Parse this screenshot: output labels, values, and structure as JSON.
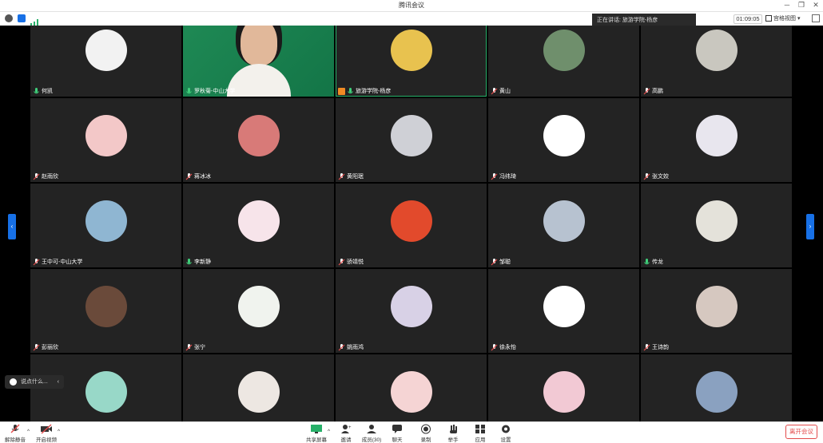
{
  "window": {
    "title": "腾讯会议"
  },
  "infobar": {
    "speaking": "正在讲话: 旅游学院-杨彦",
    "timer": "01:09:05",
    "view_label": "宫格视图"
  },
  "participants": [
    {
      "name": "何凯",
      "muted": false,
      "avatar": "stickfigure"
    },
    {
      "name": "罗秋菊-中山大学",
      "muted": false,
      "avatar": "video"
    },
    {
      "name": "旅游学院-杨彦",
      "muted": false,
      "avatar": "flowers",
      "active": true,
      "host": true
    },
    {
      "name": "黄山",
      "muted": true,
      "avatar": "mountain"
    },
    {
      "name": "高鹏",
      "muted": true,
      "avatar": "girl-outdoor"
    },
    {
      "name": "赵雨欣",
      "muted": true,
      "avatar": "pink-cartoon"
    },
    {
      "name": "蒋冰冰",
      "muted": true,
      "avatar": "person-blonde"
    },
    {
      "name": "黄阳珉",
      "muted": true,
      "avatar": "girl-hair"
    },
    {
      "name": "冯纬琦",
      "muted": true,
      "avatar": "cartoon-boy"
    },
    {
      "name": "张文姣",
      "muted": true,
      "avatar": "anime-girl"
    },
    {
      "name": "王中可-中山大学",
      "muted": true,
      "avatar": "sea-sky"
    },
    {
      "name": "李新静",
      "muted": false,
      "avatar": "two-girls"
    },
    {
      "name": "骄靖悦",
      "muted": true,
      "avatar": "cartoon-red"
    },
    {
      "name": "邹聪",
      "muted": true,
      "avatar": "lake"
    },
    {
      "name": "传龙",
      "muted": false,
      "avatar": "street-person"
    },
    {
      "name": "彭丽欣",
      "muted": true,
      "avatar": "dark-portrait"
    },
    {
      "name": "张宁",
      "muted": true,
      "avatar": "leaves"
    },
    {
      "name": "姚雨鸿",
      "muted": true,
      "avatar": "cartoon-bw"
    },
    {
      "name": "徐永怡",
      "muted": true,
      "avatar": "fish"
    },
    {
      "name": "王诗韵",
      "muted": true,
      "avatar": "room-girl"
    },
    {
      "name": "",
      "muted": false,
      "avatar": "dog"
    },
    {
      "name": "",
      "muted": false,
      "avatar": "girl-cat"
    },
    {
      "name": "",
      "muted": false,
      "avatar": "pink-cat"
    },
    {
      "name": "",
      "muted": false,
      "avatar": "white-dog"
    },
    {
      "name": "",
      "muted": false,
      "avatar": "sunset-person"
    }
  ],
  "chat": {
    "placeholder": "说点什么..."
  },
  "toolbar": {
    "mute": "解除静音",
    "video": "开启视频",
    "share": "共享屏幕",
    "invite": "邀请",
    "members": "成员(30)",
    "chat": "聊天",
    "record": "录制",
    "raise_hand": "举手",
    "apps": "应用",
    "settings": "设置",
    "leave": "离开会议"
  },
  "colors": {
    "accent": "#1770e6",
    "active_border": "#27b069",
    "leave": "#e34b4b"
  }
}
